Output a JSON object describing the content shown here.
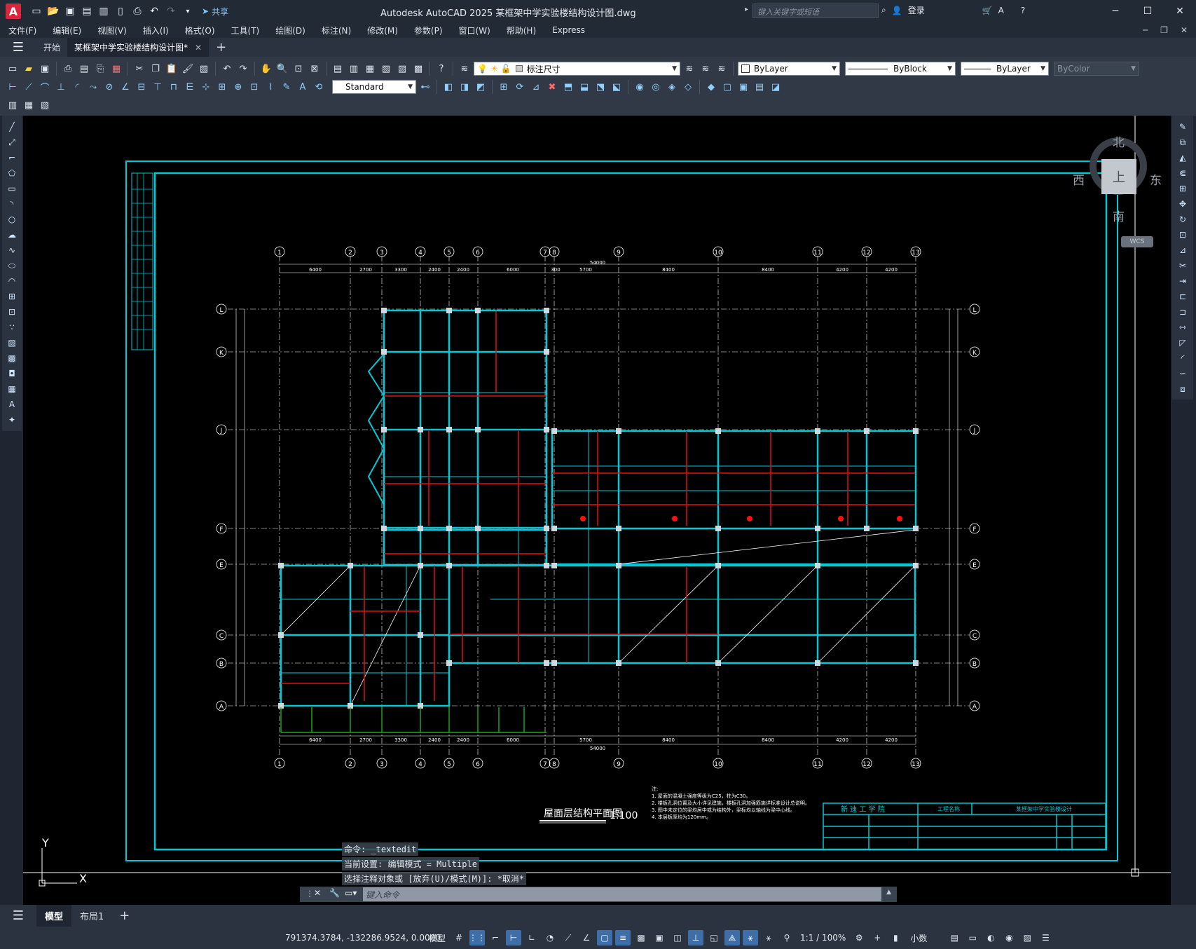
{
  "title_bar": {
    "logo": "A",
    "share_label": "共享",
    "window_title": "Autodesk AutoCAD 2025    某框架中学实验楼结构设计图.dwg",
    "search_placeholder": "键入关键字或短语",
    "login_label": "登录"
  },
  "menu": [
    "文件(F)",
    "编辑(E)",
    "视图(V)",
    "插入(I)",
    "格式(O)",
    "工具(T)",
    "绘图(D)",
    "标注(N)",
    "修改(M)",
    "参数(P)",
    "窗口(W)",
    "帮助(H)",
    "Express"
  ],
  "tabs": {
    "start": "开始",
    "active_doc": "某框架中学实验楼结构设计图*"
  },
  "toolbar": {
    "dim_style": "标注尺寸",
    "text_style": "Standard",
    "color": "ByLayer",
    "linetype": "ByBlock",
    "lineweight": "ByLayer",
    "plot_style": "ByColor"
  },
  "viewcube": {
    "north": "北",
    "south": "南",
    "east": "东",
    "west": "西",
    "top": "上",
    "wcs": "WCS"
  },
  "drawing": {
    "title": "屋面层结构平面图",
    "scale": "1:100",
    "grid_numbers": [
      "1",
      "2",
      "3",
      "4",
      "5",
      "6",
      "7",
      "8",
      "9",
      "10",
      "11",
      "12",
      "13"
    ],
    "grid_letters": [
      "L",
      "K",
      "J",
      "F",
      "E",
      "C",
      "B",
      "A"
    ],
    "top_dims": [
      "6400",
      "2700",
      "3300",
      "2400",
      "2400",
      "6000",
      "300",
      "5700",
      "8400",
      "8400",
      "4200",
      "4200"
    ],
    "total_dim": "54000",
    "notes": [
      "注:",
      "1. 屋面的混凝土强度等级为C25，柱为C30。",
      "2. 楼板孔洞位置及大小详见建施，楼板孔洞加强筋施详标准设计总说明。",
      "3. 图中未定位的梁均居中或为结构外，梁标均以轴线为梁中心线。",
      "4. 本层板厚均为120mm。"
    ],
    "title_block": {
      "school": "新 迪 工 学 院",
      "project_label": "工程名称",
      "project": "某框架中学实验楼设计"
    }
  },
  "command": {
    "history": [
      "命令: _textedit",
      "当前设置: 编辑模式 = Multiple",
      "选择注释对象或 [放弃(U)/模式(M)]: *取消*"
    ],
    "input_placeholder": "键入命令"
  },
  "layout_tabs": [
    "模型",
    "布局1"
  ],
  "status": {
    "coordinates": "791374.3784, -132286.9524, 0.0000",
    "model_label": "模型",
    "scale": "1:1 / 100%",
    "units": "小数"
  },
  "ucs": {
    "x": "X",
    "y": "Y"
  }
}
